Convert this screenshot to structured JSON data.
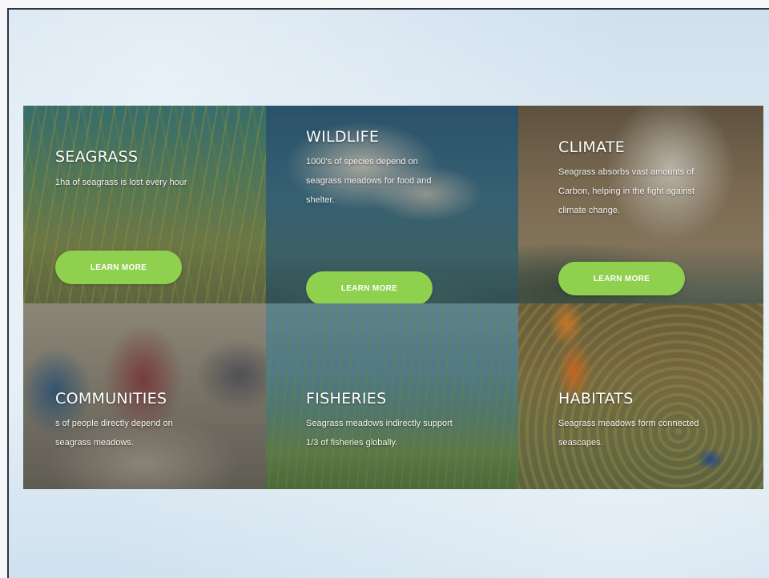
{
  "tiles": [
    {
      "title": "SEAGRASS",
      "description": "1ha of seagrass is lost every hour",
      "button_label": "LEARN MORE"
    },
    {
      "title": "WILDLIFE",
      "description_lines": [
        "1000's of species depend on",
        "seagrass meadows for food and",
        "shelter."
      ],
      "button_label": "LEARN MORE"
    },
    {
      "title": "CLIMATE",
      "description_lines": [
        "Seagrass absorbs vast amounts of",
        "Carbon, helping in the fight against",
        "climate change."
      ],
      "button_label": "LEARN MORE"
    },
    {
      "title": "COMMUNITIES",
      "description_lines": [
        "s of people directly depend on",
        "seagrass meadows."
      ]
    },
    {
      "title": "FISHERIES",
      "description_lines": [
        "Seagrass meadows indirectly support",
        "1/3 of fisheries globally."
      ]
    },
    {
      "title": "HABITATS",
      "description_lines": [
        "Seagrass meadows form connected",
        "seascapes."
      ]
    }
  ],
  "colors": {
    "button": "#8fd14f",
    "title_text": "#ffffff"
  },
  "images": [
    "seagrass-photo",
    "dugong-photo",
    "smokestack-photo",
    "fishing-community-photo",
    "seagrass-meadow-underwater-photo",
    "clownfish-reef-photo"
  ]
}
